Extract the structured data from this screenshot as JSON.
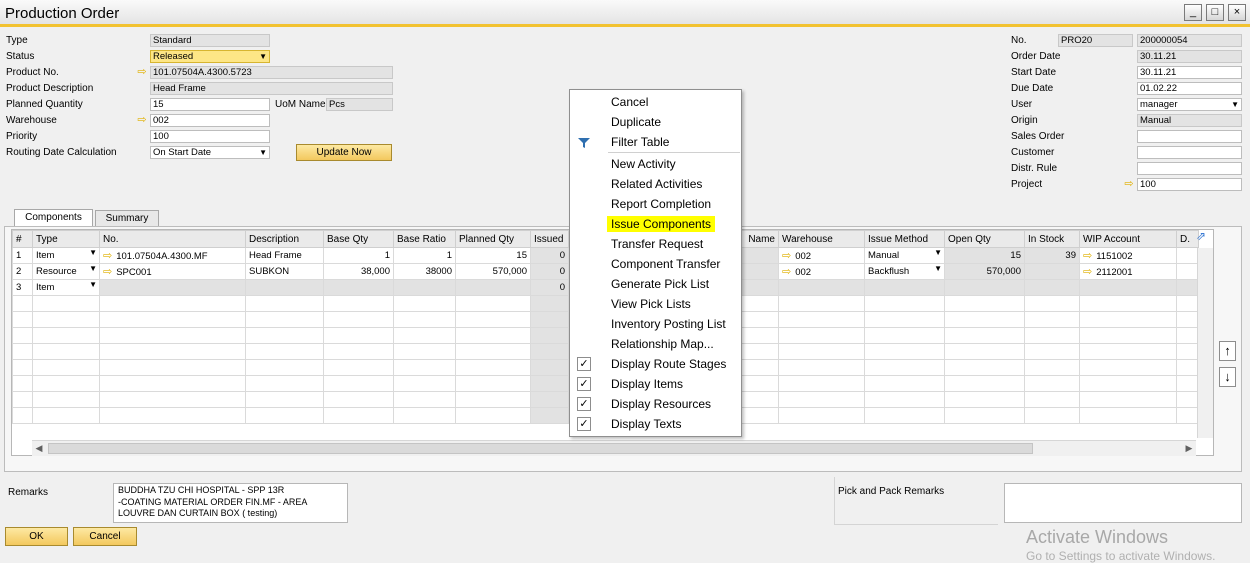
{
  "window": {
    "title": "Production Order",
    "controls": [
      "_",
      "□",
      "×"
    ]
  },
  "header_left": {
    "type_label": "Type",
    "type_value": "Standard",
    "status_label": "Status",
    "status_value": "Released",
    "product_no_label": "Product No.",
    "product_no_value": "101.07504A.4300.5723",
    "product_desc_label": "Product Description",
    "product_desc_value": "Head Frame",
    "planned_qty_label": "Planned Quantity",
    "planned_qty_value": "15",
    "uom_label": "UoM Name",
    "uom_value": "Pcs",
    "warehouse_label": "Warehouse",
    "warehouse_value": "002",
    "priority_label": "Priority",
    "priority_value": "100",
    "routing_label": "Routing Date Calculation",
    "routing_value": "On Start Date",
    "update_button": "Update Now"
  },
  "header_right": {
    "no_label": "No.",
    "series_value": "PRO20",
    "no_value": "200000054",
    "order_date_label": "Order Date",
    "order_date_value": "30.11.21",
    "start_date_label": "Start Date",
    "start_date_value": "30.11.21",
    "due_date_label": "Due Date",
    "due_date_value": "01.02.22",
    "user_label": "User",
    "user_value": "manager",
    "origin_label": "Origin",
    "origin_value": "Manual",
    "sales_order_label": "Sales Order",
    "sales_order_value": "",
    "customer_label": "Customer",
    "customer_value": "",
    "distr_rule_label": "Distr. Rule",
    "distr_rule_value": "",
    "project_label": "Project",
    "project_value": "100"
  },
  "tabs": [
    "Components",
    "Summary"
  ],
  "grid": {
    "columns": [
      "#",
      "Type",
      "No.",
      "Description",
      "Base Qty",
      "Base Ratio",
      "Planned Qty",
      "Issued",
      "Name",
      "Warehouse",
      "Issue Method",
      "Open Qty",
      "In Stock",
      "WIP Account",
      "D."
    ],
    "rows": [
      {
        "num": "1",
        "type": "Item",
        "no": "101.07504A.4300.MF",
        "desc": "Head Frame",
        "base_qty": "1",
        "base_ratio": "1",
        "planned": "15",
        "issued": "0",
        "warehouse": "002",
        "method": "Manual",
        "open_qty": "15",
        "in_stock": "39",
        "wip": "1151002"
      },
      {
        "num": "2",
        "type": "Resource",
        "no": "SPC001",
        "desc": "SUBKON",
        "base_qty": "38,000",
        "base_ratio": "38000",
        "planned": "570,000",
        "issued": "0",
        "warehouse": "002",
        "method": "Backflush",
        "open_qty": "570,000",
        "in_stock": "",
        "wip": "2112001"
      },
      {
        "num": "3",
        "type": "Item",
        "no": "",
        "desc": "",
        "base_qty": "",
        "base_ratio": "",
        "planned": "",
        "issued": "0",
        "warehouse": "",
        "method": "",
        "open_qty": "",
        "in_stock": "",
        "wip": ""
      }
    ]
  },
  "context_menu": {
    "items": [
      "Cancel",
      "Duplicate",
      "Filter Table",
      "New Activity",
      "Related Activities",
      "Report Completion",
      "Issue Components",
      "Transfer Request",
      "Component Transfer",
      "Generate Pick List",
      "View Pick Lists",
      "Inventory Posting List",
      "Relationship Map...",
      "Display Route Stages",
      "Display Items",
      "Display Resources",
      "Display Texts"
    ],
    "highlighted": "Issue Components",
    "checked": [
      "Display Route Stages",
      "Display Items",
      "Display Resources",
      "Display Texts"
    ]
  },
  "footer": {
    "remarks_label": "Remarks",
    "remarks_lines": [
      "BUDDHA TZU CHI HOSPITAL - SPP 13R",
      "-COATING MATERIAL ORDER FIN.MF - AREA",
      "LOUVRE DAN CURTAIN  BOX ( testing)"
    ],
    "pick_pack_label": "Pick and Pack Remarks",
    "ok_button": "OK",
    "cancel_button": "Cancel"
  },
  "watermark": {
    "title": "Activate Windows",
    "subtitle": "Go to Settings to activate Windows."
  },
  "colors": {
    "accent": "#f2c230",
    "highlight": "#ffff00",
    "button": "#f3c85e"
  }
}
